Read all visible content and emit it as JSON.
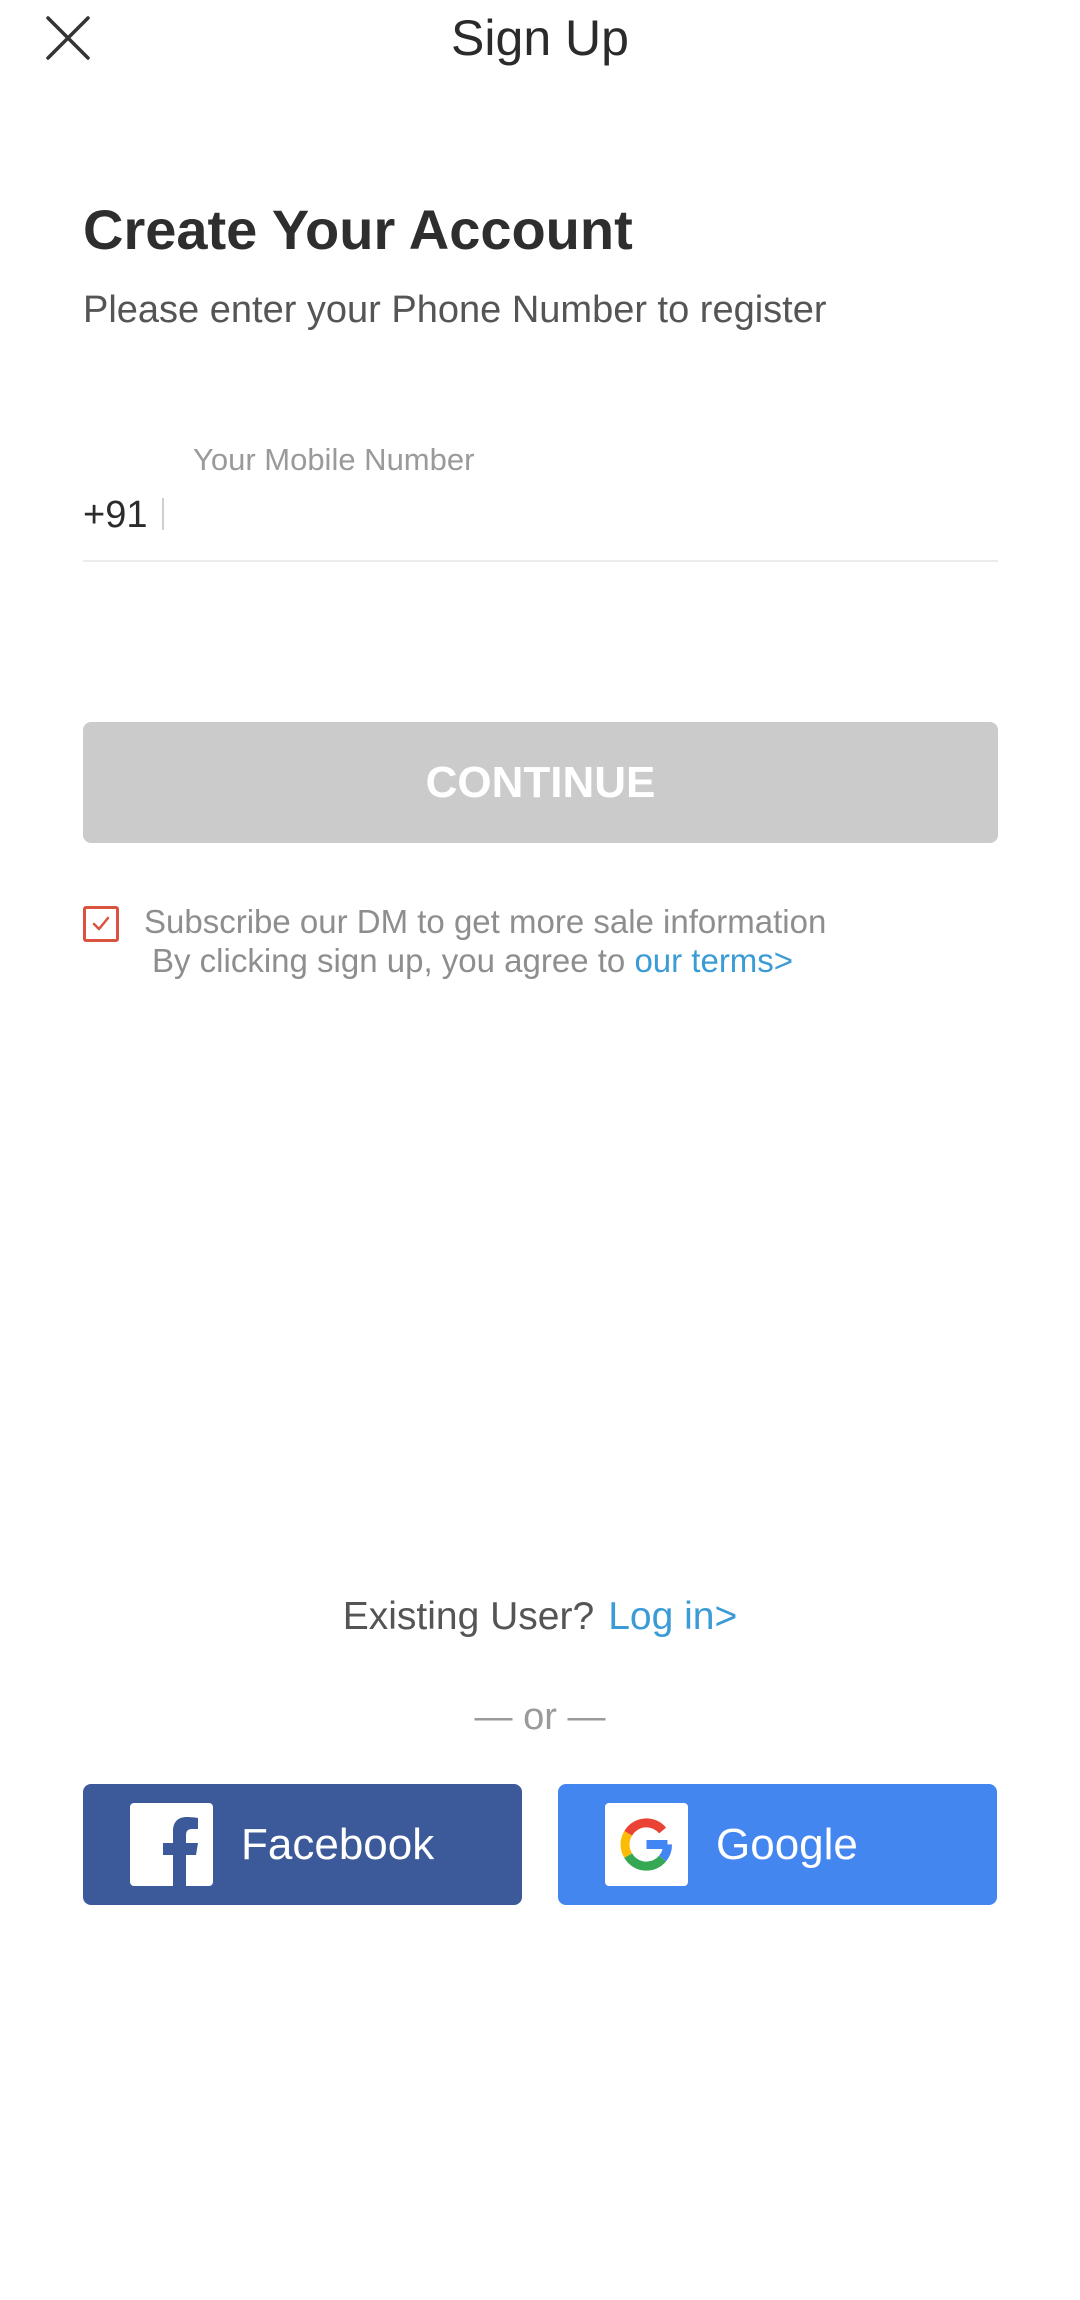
{
  "header": {
    "title": "Sign Up",
    "close_icon": "close-icon"
  },
  "intro": {
    "title": "Create Your Account",
    "subtitle": "Please enter your Phone Number to register"
  },
  "phone": {
    "label": "Your Mobile Number",
    "country_code": "+91",
    "value": "",
    "placeholder": ""
  },
  "continue_button": {
    "label": "CONTINUE",
    "enabled": false
  },
  "subscribe": {
    "checked": true,
    "text": "Subscribe our DM to get more sale information",
    "terms_prefix": "By clicking sign up, you agree to ",
    "terms_link": "our terms>"
  },
  "login": {
    "prompt": "Existing User?",
    "link": "Log in>"
  },
  "divider_text": "— or —",
  "social": {
    "facebook": {
      "label": "Facebook",
      "icon": "facebook-icon",
      "color": "#3c5a99"
    },
    "google": {
      "label": "Google",
      "icon": "google-icon",
      "color": "#4486ef"
    }
  },
  "colors": {
    "link": "#3b9bd6",
    "checkbox_accent": "#d9533e",
    "disabled_button": "#cbcbcb"
  }
}
